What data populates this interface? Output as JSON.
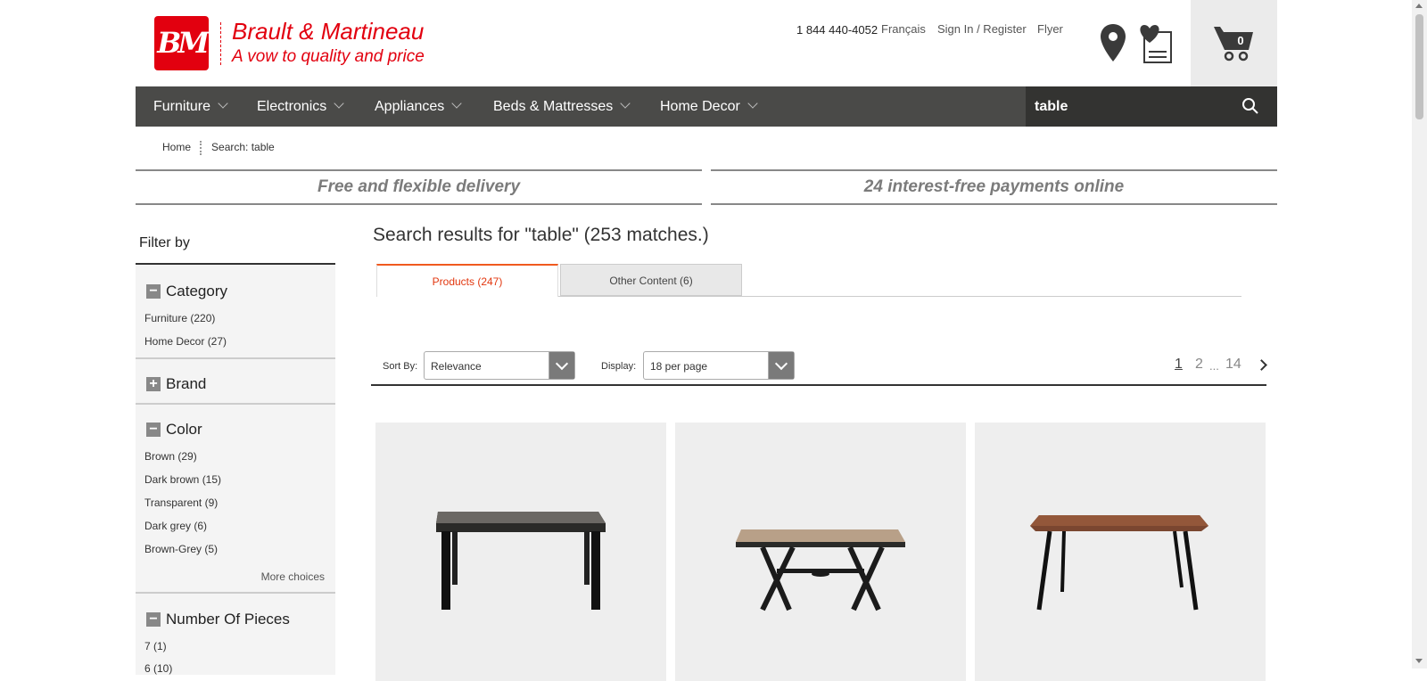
{
  "brand": {
    "logo_letters": "BM",
    "name": "Brault & Martineau",
    "tagline": "A vow to quality and price",
    "accent_color": "#e2000f"
  },
  "header": {
    "phone": "1 844 440-4052",
    "links": [
      "Français",
      "Sign In / Register",
      "Flyer"
    ],
    "icons": [
      "location-pin-icon",
      "wishlist-icon",
      "cart-icon"
    ],
    "cart_count": "0"
  },
  "nav": {
    "items": [
      "Furniture",
      "Electronics",
      "Appliances",
      "Beds & Mattresses",
      "Home Decor"
    ],
    "search_value": "table"
  },
  "breadcrumb": [
    "Home",
    "Search: table"
  ],
  "banners": [
    "Free and flexible delivery",
    "24 interest-free payments online"
  ],
  "filters": {
    "title": "Filter by",
    "sections": [
      {
        "name": "Category",
        "expanded": true,
        "items": [
          "Furniture (220)",
          "Home Decor (27)"
        ]
      },
      {
        "name": "Brand",
        "expanded": false,
        "items": []
      },
      {
        "name": "Color",
        "expanded": true,
        "items": [
          "Brown (29)",
          "Dark brown (15)",
          "Transparent (9)",
          "Dark grey (6)",
          "Brown-Grey (5)"
        ],
        "more": "More choices"
      },
      {
        "name": "Number Of Pieces",
        "expanded": true,
        "items": [
          "7 (1)",
          "6 (10)"
        ]
      }
    ]
  },
  "results": {
    "title": "Search results for \"table\" (253 matches.)",
    "tabs": [
      "Products (247)",
      "Other Content (6)"
    ],
    "sort_label": "Sort By:",
    "sort_value": "Relevance",
    "display_label": "Display:",
    "display_value": "18 per page",
    "pages": [
      "1",
      "2",
      "...",
      "14"
    ]
  },
  "products": [
    {
      "icon": "dark-top-dining-table-image"
    },
    {
      "icon": "wood-top-patio-table-image"
    },
    {
      "icon": "walnut-table-black-legs-image"
    }
  ]
}
